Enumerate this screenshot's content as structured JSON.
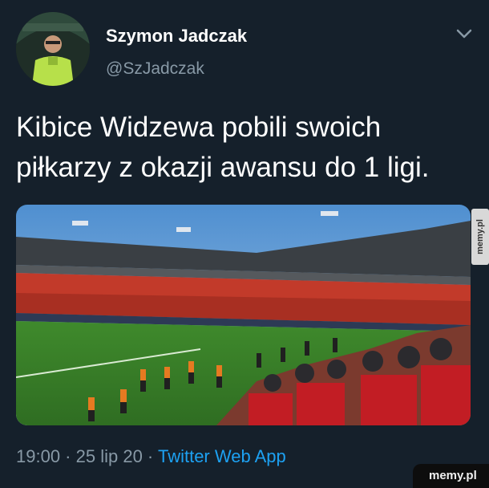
{
  "tweet": {
    "author_name": "Szymon Jadczak",
    "author_handle": "@SzJadczak",
    "text": "Kibice Widzewa pobili swoich\npiłkarzy z okazji awansu do 1 ligi.",
    "time": "19:00",
    "separator_1": " · ",
    "date": "25 lip 20",
    "separator_2": " · ",
    "source_app": "Twitter Web App"
  },
  "icons": {
    "menu": "chevron-down-icon",
    "avatar": "avatar-photo",
    "media": "stadium-photo"
  },
  "watermark": {
    "side": "memy.pl",
    "corner": "memy.pl"
  },
  "colors": {
    "background": "#15202b",
    "secondary_text": "#8899a6",
    "link": "#1da1f2"
  }
}
